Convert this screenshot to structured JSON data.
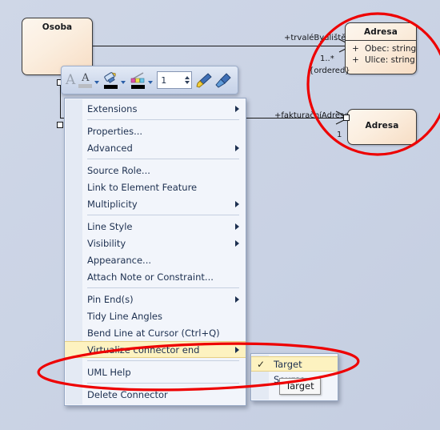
{
  "canvas": {
    "background_color": "#ccd5e6",
    "classes": [
      {
        "name": "Osoba",
        "attributes": []
      },
      {
        "name": "Adresa",
        "attributes": [
          {
            "visibility": "+",
            "text": "Obec: string"
          },
          {
            "visibility": "+",
            "text": "Ulice: string"
          }
        ]
      },
      {
        "name": "Adresa",
        "attributes": []
      }
    ],
    "connectors": [
      {
        "role_label": "+trvaléBydliště",
        "multiplicity": "1..*",
        "constraint": "{ordered}"
      },
      {
        "role_label": "+fakturačníAdresa",
        "multiplicity": "1",
        "constraint": ""
      }
    ]
  },
  "toolbar": {
    "font_style_icon": "font-icon",
    "font_color_icon": "font-color-icon",
    "fill_color_icon": "fill-color-icon",
    "line_color_icon": "line-color-icon",
    "line_width_value": "1",
    "format_painter_icon": "format-painter-icon",
    "eyedropper_icon": "eyedropper-icon",
    "font_color_swatch": "#b9bcc2",
    "fill_color_swatch": "#000000",
    "line_color_swatch": "#000000"
  },
  "context_menu": {
    "items": [
      {
        "label": "Extensions",
        "submenu": true,
        "separator_after": true
      },
      {
        "label": "Properties...",
        "submenu": false,
        "separator_after": false
      },
      {
        "label": "Advanced",
        "submenu": true,
        "separator_after": true
      },
      {
        "label": "Source Role...",
        "submenu": false,
        "separator_after": false
      },
      {
        "label": "Link to Element Feature",
        "submenu": false,
        "separator_after": false
      },
      {
        "label": "Multiplicity",
        "submenu": true,
        "separator_after": true
      },
      {
        "label": "Line Style",
        "submenu": true,
        "separator_after": false
      },
      {
        "label": "Visibility",
        "submenu": true,
        "separator_after": false
      },
      {
        "label": "Appearance...",
        "submenu": false,
        "separator_after": false
      },
      {
        "label": "Attach Note or Constraint...",
        "submenu": false,
        "separator_after": true
      },
      {
        "label": "Pin End(s)",
        "submenu": true,
        "separator_after": false
      },
      {
        "label": "Tidy Line Angles",
        "submenu": false,
        "separator_after": false
      },
      {
        "label": "Bend Line at Cursor (Ctrl+Q)",
        "submenu": false,
        "separator_after": false
      },
      {
        "label": "Virtualize connector end",
        "submenu": true,
        "separator_after": true,
        "selected": true
      },
      {
        "label": "UML Help",
        "submenu": false,
        "separator_after": true
      },
      {
        "label": "Delete Connector",
        "submenu": false,
        "separator_after": false
      }
    ]
  },
  "submenu": {
    "items": [
      {
        "label": "Target",
        "checked": true,
        "selected": true
      },
      {
        "label": "Source",
        "checked": false,
        "selected": false
      }
    ]
  },
  "tooltip": {
    "text": "Target"
  },
  "annotation": {
    "color": "#ee0000"
  }
}
